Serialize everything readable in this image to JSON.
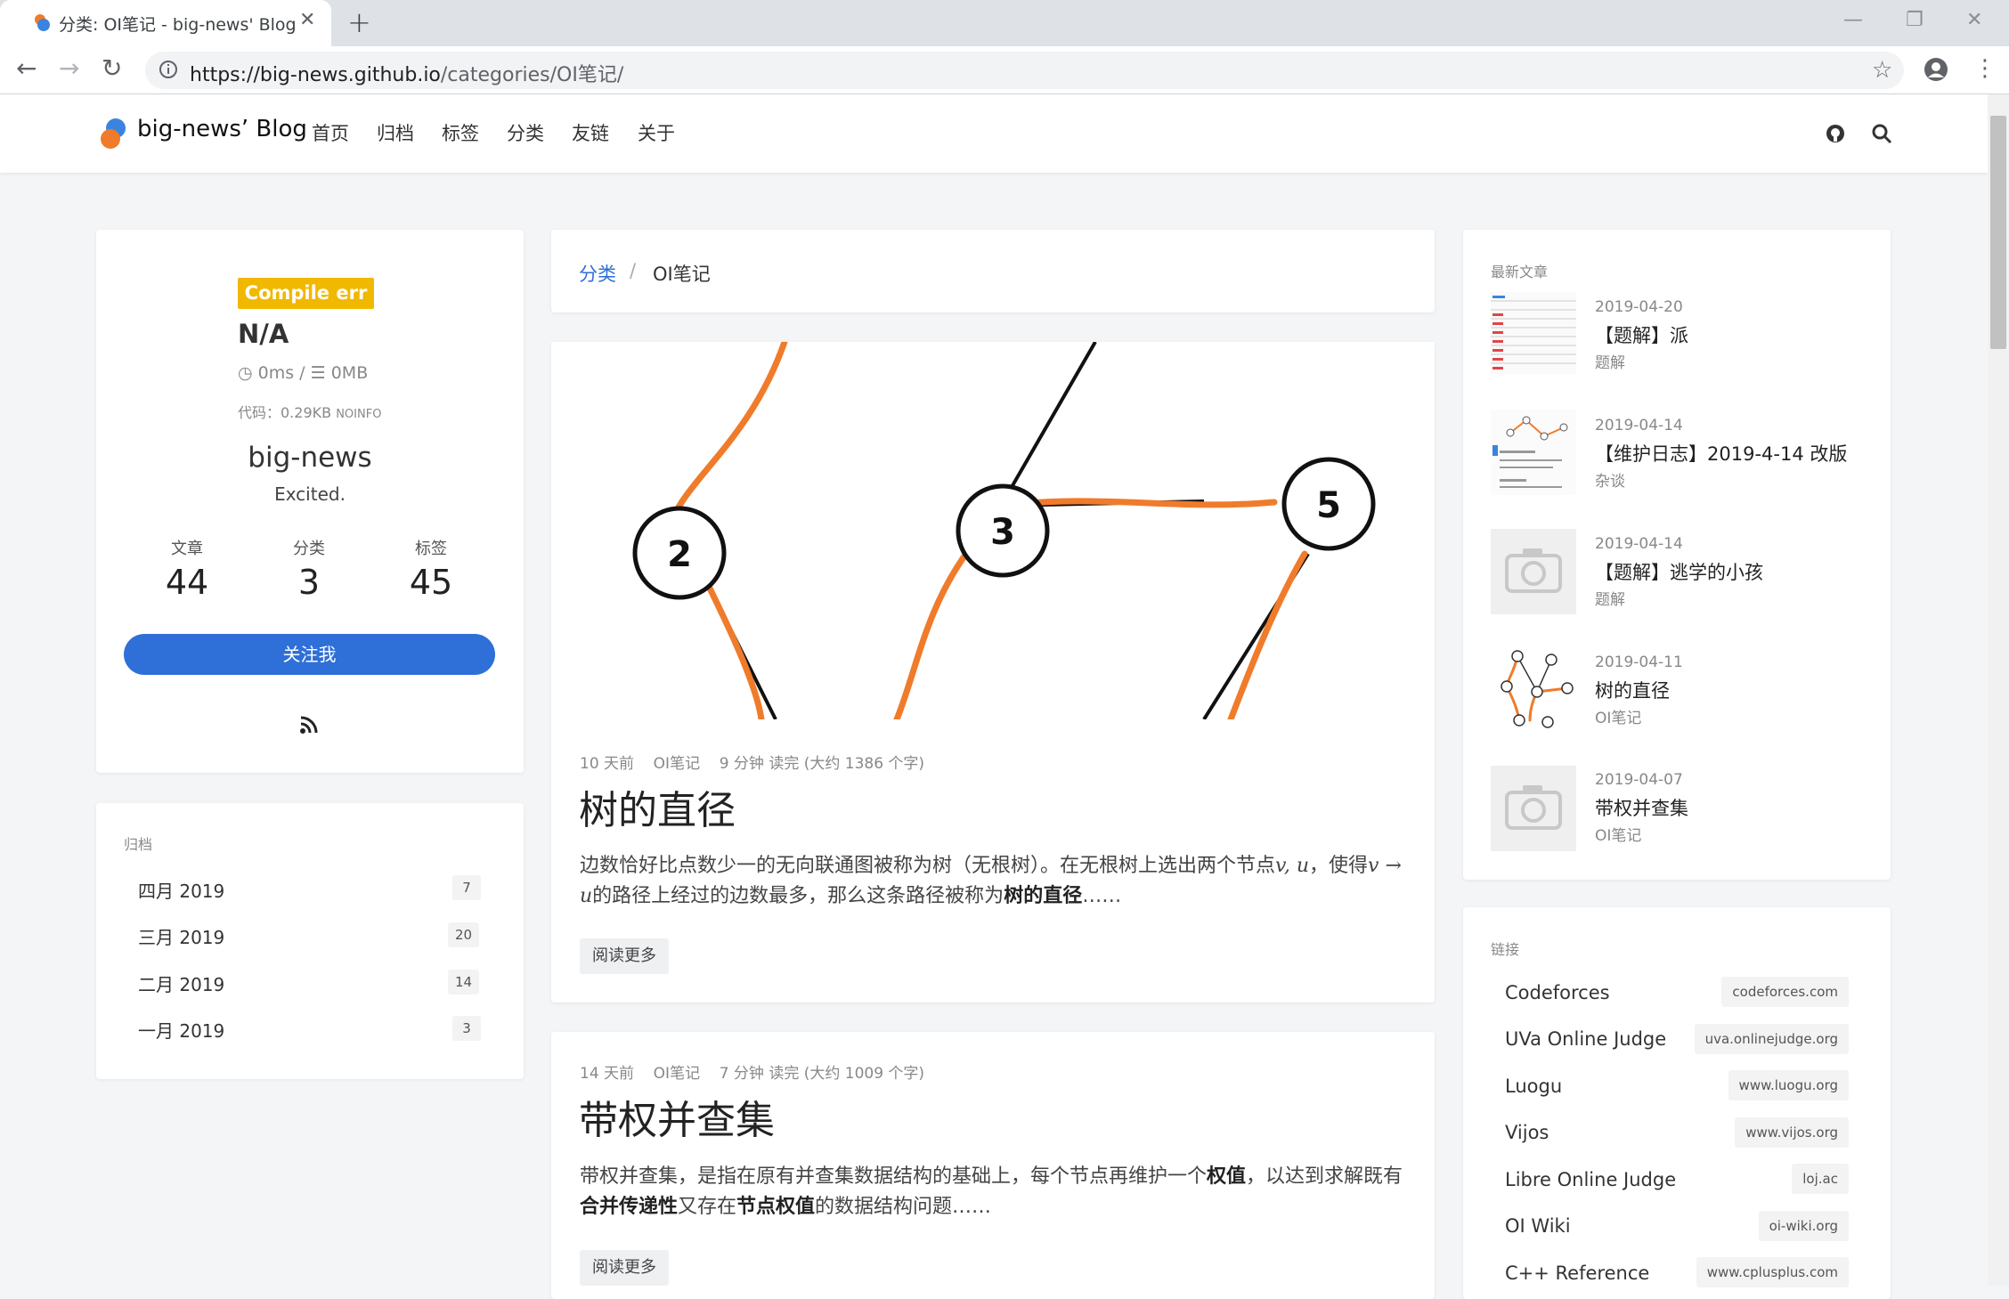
{
  "browser": {
    "tab_title": "分类: OI笔记 - big-news' Blog",
    "url_host": "https://big-news.github.io",
    "url_path": "/categories/OI笔记/"
  },
  "site": {
    "brand": "big-news’ Blog",
    "menu": [
      "首页",
      "归档",
      "标签",
      "分类",
      "友链",
      "关于"
    ]
  },
  "profile": {
    "badge": "Compile err",
    "status": "N/A",
    "time_mem": "0ms / ",
    "mem": "0MB",
    "code": "代码：0.29KB",
    "code_suffix": "NOINFO",
    "name": "big-news",
    "motto": "Excited.",
    "stats": [
      {
        "label": "文章",
        "value": "44"
      },
      {
        "label": "分类",
        "value": "3"
      },
      {
        "label": "标签",
        "value": "45"
      }
    ],
    "follow": "关注我"
  },
  "archive": {
    "heading": "归档",
    "items": [
      {
        "month": "四月 2019",
        "count": "7"
      },
      {
        "month": "三月 2019",
        "count": "20"
      },
      {
        "month": "二月 2019",
        "count": "14"
      },
      {
        "month": "一月 2019",
        "count": "3"
      }
    ]
  },
  "breadcrumb": {
    "root": "分类",
    "sep": "/",
    "current": "OI笔记"
  },
  "graph_labels": [
    "2",
    "3",
    "5"
  ],
  "posts": [
    {
      "age": "10 天前",
      "category": "OI笔记",
      "read": "9 分钟 读完 (大约 1386 个字)",
      "title": "树的直径",
      "excerpt_a": "边数恰好比点数少一的无向联通图被称为树（无根树）。在无根树上选出两个节点",
      "excerpt_math1": "v, u",
      "excerpt_b": "，使得",
      "excerpt_math2": "v → u",
      "excerpt_c": "的路径上经过的边数最多，那么这条路径被称为",
      "excerpt_bold": "树的直径",
      "excerpt_end": "……",
      "readmore": "阅读更多"
    },
    {
      "age": "14 天前",
      "category": "OI笔记",
      "read": "7 分钟 读完 (大约 1009 个字)",
      "title": "带权并查集",
      "excerpt_a": "带权并查集，是指在原有并查集数据结构的基础上，每个节点再维护一个",
      "bold1": "权值",
      "excerpt_b": "，以达到求解既有",
      "bold2": "合并传递性",
      "excerpt_c": "又存在",
      "bold3": "节点权值",
      "excerpt_d": "的数据结构问题……",
      "readmore": "阅读更多"
    }
  ],
  "recent": {
    "heading": "最新文章",
    "items": [
      {
        "date": "2019-04-20",
        "title": "【题解】派",
        "cat": "题解"
      },
      {
        "date": "2019-04-14",
        "title": "【维护日志】2019-4-14 改版",
        "cat": "杂谈"
      },
      {
        "date": "2019-04-14",
        "title": "【题解】逃学的小孩",
        "cat": "题解"
      },
      {
        "date": "2019-04-11",
        "title": "树的直径",
        "cat": "OI笔记"
      },
      {
        "date": "2019-04-07",
        "title": "带权并查集",
        "cat": "OI笔记"
      }
    ]
  },
  "links": {
    "heading": "链接",
    "items": [
      {
        "name": "Codeforces",
        "url": "codeforces.com"
      },
      {
        "name": "UVa Online Judge",
        "url": "uva.onlinejudge.org"
      },
      {
        "name": "Luogu",
        "url": "www.luogu.org"
      },
      {
        "name": "Vijos",
        "url": "www.vijos.org"
      },
      {
        "name": "Libre Online Judge",
        "url": "loj.ac"
      },
      {
        "name": "OI Wiki",
        "url": "oi-wiki.org"
      },
      {
        "name": "C++ Reference",
        "url": "www.cplusplus.com"
      }
    ]
  },
  "colors": {
    "accent": "#2f6fd8",
    "badge": "#f1b800",
    "edge": "#f07b2a"
  }
}
